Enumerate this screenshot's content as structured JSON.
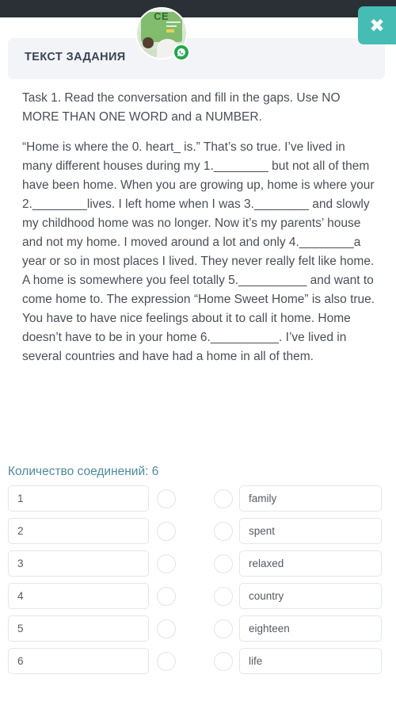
{
  "window": {
    "topbar_color": "#2b2f36"
  },
  "close_button": {
    "label": "✖",
    "icon": "close-icon",
    "color": "#45bdb4"
  },
  "header": {
    "title": "ТЕКСТ ЗАДАНИЯ"
  },
  "avatar": {
    "image_text": "CE",
    "badge_icon": "whatsapp-icon",
    "badge_color": "#1faa4b"
  },
  "task": {
    "instruction": "Task 1. Read the conversation and fill in the gaps. Use NO MORE THAN ONE WORD and a NUMBER.",
    "passage": "“Home is where the 0. heart_ is.” That’s so true. I’ve lived in many different houses during my 1.________ but not all of them have been home. When you are growing up, home is where your 2.________lives. I left home when I was 3.________ and slowly my childhood home was no longer. Now it’s my parents’ house and not my home. I moved around a lot and only 4.________a year or so in most places I lived. They never really felt like home. A home is somewhere you feel totally 5.__________ and want to come home to. The expression “Home Sweet Home” is also true. You have to have nice feelings about it to call it home. Home doesn’t have to be in your home 6.__________. I’ve lived in several countries and have had a home in all of them."
  },
  "connections": {
    "label": "Количество соединений: 6",
    "count": 6,
    "color": "#4d8b99"
  },
  "match_rows": [
    {
      "left": "1",
      "right": "family"
    },
    {
      "left": "2",
      "right": "spent"
    },
    {
      "left": "3",
      "right": "relaxed"
    },
    {
      "left": "4",
      "right": "country"
    },
    {
      "left": "5",
      "right": "eighteen"
    },
    {
      "left": "6",
      "right": "life"
    }
  ]
}
